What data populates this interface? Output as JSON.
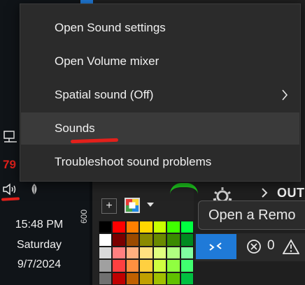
{
  "tray": {
    "red_number": "79",
    "clock_time": "15:48 PM",
    "clock_day": "Saturday",
    "clock_date": "9/7/2024"
  },
  "app": {
    "ruler_value": "600",
    "out_label": "OUT",
    "tooltip_text": "Open a Remo",
    "error_count": "0",
    "swatch_colors": [
      "#000000",
      "#ff0000",
      "#ff8000",
      "#ffd700",
      "#c8ff00",
      "#40ff00",
      "#00ff40",
      "#ffffff",
      "#7a0000",
      "#9a4a00",
      "#8a8a00",
      "#6a8a00",
      "#3a8a00",
      "#008a20",
      "#d9d9d9",
      "#ff8080",
      "#ffb080",
      "#ffe080",
      "#e0ff80",
      "#b0ff80",
      "#80ffa0",
      "#a0a0a0",
      "#ff4040",
      "#ff9040",
      "#ffd040",
      "#d0ff40",
      "#90ff40",
      "#40ff70",
      "#707070",
      "#c00000",
      "#c06000",
      "#c0a000",
      "#a0c000",
      "#60c000",
      "#00c040"
    ]
  },
  "menu": {
    "items": [
      {
        "label": "Open Sound settings"
      },
      {
        "label": "Open Volume mixer"
      },
      {
        "label": "Spatial sound (Off)"
      },
      {
        "label": "Sounds"
      },
      {
        "label": "Troubleshoot sound problems"
      }
    ]
  },
  "colors": {
    "accent_blue": "#1f7ad8",
    "annotation_red": "#e3201b",
    "menu_bg": "#2b2b2b",
    "menu_hover": "#3a3a3a"
  }
}
